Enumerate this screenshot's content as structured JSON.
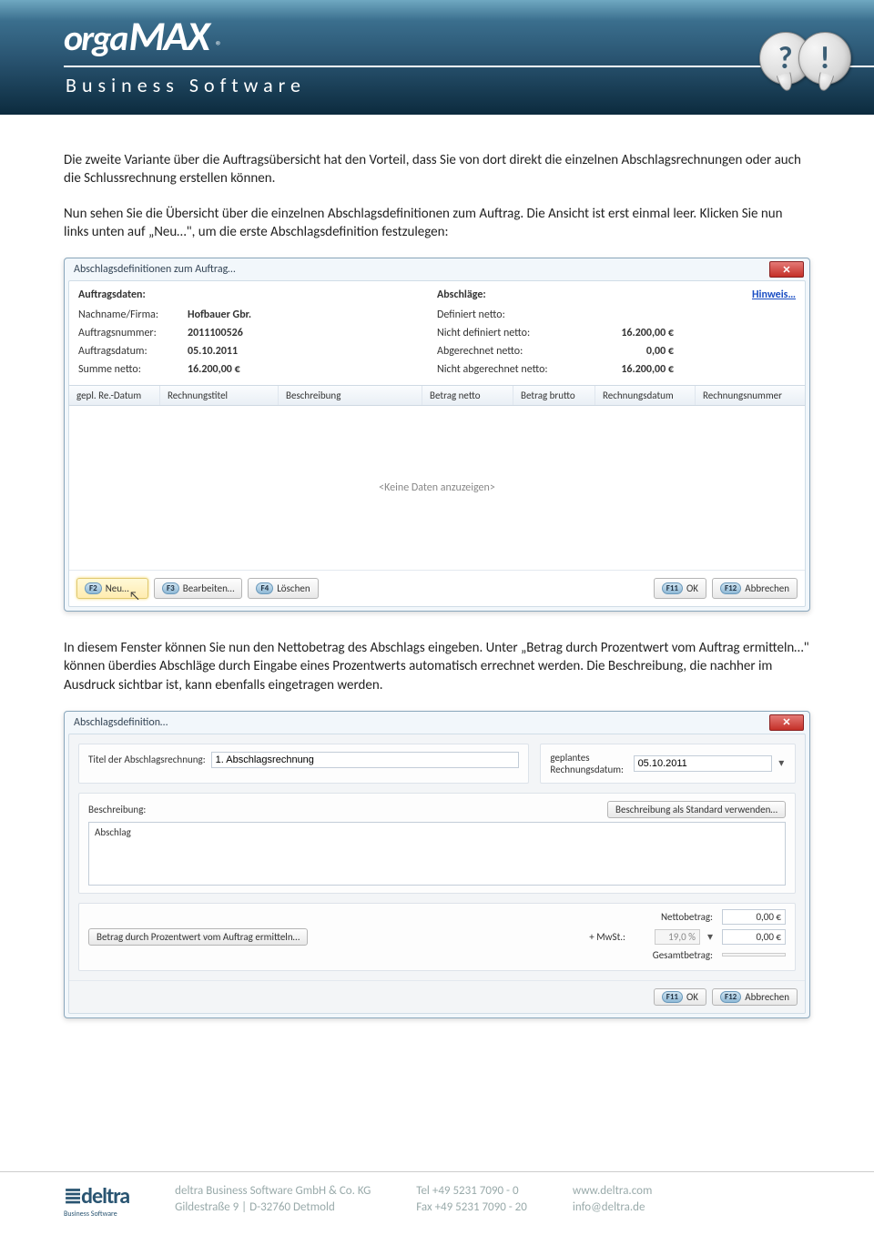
{
  "header": {
    "logo1": "orga",
    "logo2": "MAX",
    "reg": "®",
    "sub": "Business Software",
    "help1": "?",
    "help2": "!"
  },
  "para1": "Die zweite Variante über die Auftragsübersicht hat den Vorteil, dass Sie von dort direkt die einzelnen Abschlagsrechnungen oder auch die Schlussrechnung erstellen können.",
  "para2": "Nun sehen Sie die Übersicht über die einzelnen Abschlagsdefinitionen zum Auftrag. Die Ansicht ist erst einmal leer. Klicken Sie nun links unten auf „Neu…\", um die erste Abschlagsdefinition festzulegen:",
  "win1": {
    "title": "Abschlagsdefinitionen zum Auftrag…",
    "left_head": "Auftragsdaten:",
    "right_head": "Abschläge:",
    "hinweis": "Hinweis…",
    "l1l": "Nachname/Firma:",
    "l1v": "Hofbauer Gbr.",
    "l2l": "Auftragsnummer:",
    "l2v": "2011100526",
    "l3l": "Auftragsdatum:",
    "l3v": "05.10.2011",
    "l4l": "Summe netto:",
    "l4v": "16.200,00 €",
    "r1l": "Definiert netto:",
    "r1v": "",
    "r2l": "Nicht definiert netto:",
    "r2v": "16.200,00 €",
    "r3l": "Abgerechnet netto:",
    "r3v": "0,00 €",
    "r4l": "Nicht abgerechnet netto:",
    "r4v": "16.200,00 €",
    "cols": {
      "c1": "gepl. Re.-Datum",
      "c2": "Rechnungstitel",
      "c3": "Beschreibung",
      "c4": "Betrag netto",
      "c5": "Betrag brutto",
      "c6": "Rechnungsdatum",
      "c7": "Rechnungsnummer"
    },
    "empty": "<Keine Daten anzuzeigen>",
    "btn": {
      "f2": "F2",
      "neu": "Neu…",
      "f3": "F3",
      "bearb": "Bearbeiten…",
      "f4": "F4",
      "loesch": "Löschen",
      "f11": "F11",
      "ok": "OK",
      "f12": "F12",
      "abbr": "Abbrechen"
    }
  },
  "para3": "In diesem Fenster können Sie nun den Nettobetrag des Abschlags eingeben. Unter „Betrag durch Prozentwert vom Auftrag ermitteln…\" können überdies Abschläge durch Eingabe eines Prozentwerts automatisch errechnet werden.  Die Beschreibung, die nachher im Ausdruck sichtbar ist, kann ebenfalls  eingetragen werden.",
  "win2": {
    "title": "Abschlagsdefinition…",
    "titel_label": "Titel der Abschlagsrechnung:",
    "titel_val": "1. Abschlagsrechnung",
    "datum_label": "geplantes Rechnungsdatum:",
    "datum_val": "05.10.2011",
    "besch_label": "Beschreibung:",
    "besch_std": "Beschreibung als Standard verwenden…",
    "besch_text": "Abschlag",
    "proz_btn": "Betrag durch Prozentwert vom Auftrag ermitteln…",
    "netto_l": "Nettobetrag:",
    "netto_v": "0,00 €",
    "mwst_l": "+  MwSt.:",
    "mwst_mid": "19,0 %",
    "mwst_v": "0,00 €",
    "gesamt_l": "Gesamtbetrag:",
    "gesamt_v": "",
    "btn": {
      "f11": "F11",
      "ok": "OK",
      "f12": "F12",
      "abbr": "Abbrechen"
    }
  },
  "footer": {
    "logo": "deltra",
    "logo_sub": "Business Software",
    "c1a": "deltra Business Software GmbH & Co. KG",
    "c1b": "Gildestraße 9   |   D-32760 Detmold",
    "c2a": "Tel  +49 5231 7090 - 0",
    "c2b": "Fax  +49 5231 7090 - 20",
    "c3a": "www.deltra.com",
    "c3b": "info@deltra.de"
  }
}
